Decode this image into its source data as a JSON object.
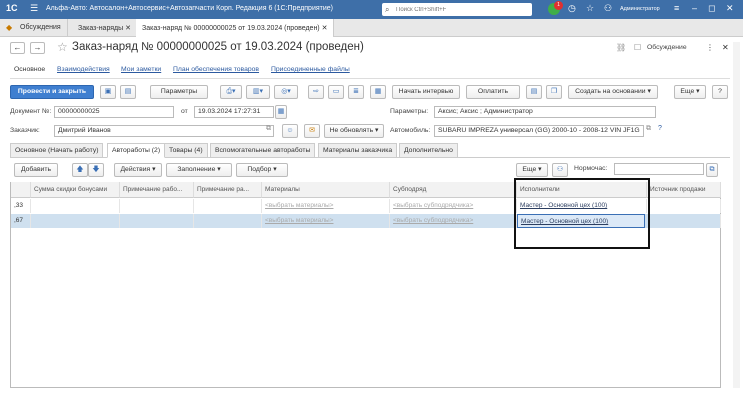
{
  "titlebar": {
    "logo": "1С",
    "title": "Альфа-Авто: Автосалон+Автосервис+Автозапчасти Корп. Редакция 6  (1С:Предприятие)",
    "search_placeholder": "Поиск Ctrl+Shift+F",
    "notif_count": "1",
    "user": "Администратор"
  },
  "tabs": [
    {
      "label": "Обсуждения"
    },
    {
      "label": "Заказ-наряды"
    },
    {
      "label": "Заказ-наряд № 00000000025 от 19.03.2024 (проведен)"
    }
  ],
  "doc": {
    "title": "Заказ-наряд № 00000000025 от 19.03.2024 (проведен)",
    "discussion_label": "Обсуждение",
    "links": [
      "Основное",
      "Взаимодействия",
      "Мои заметки",
      "План обеспечения товаров",
      "Присоединенные файлы"
    ]
  },
  "toolbar": {
    "post_close": "Провести и закрыть",
    "params": "Параметры",
    "start_interview": "Начать интервью",
    "pay": "Оплатить",
    "create_based": "Создать на основании",
    "more": "Еще",
    "help": "?"
  },
  "form": {
    "doc_no_label": "Документ №:",
    "doc_no": "00000000025",
    "from_label": "от",
    "date": "19.03.2024 17:27:31",
    "params_label": "Параметры:",
    "params_value": "Аксис; Аксис ; Администратор",
    "customer_label": "Заказчик:",
    "customer": "Дмитрий Иванов",
    "update_mode": "Не обновлять",
    "car_label": "Автомобиль:",
    "car": "SUBARU IMPREZA универсал (GG) 2000-10 - 2008-12 VIN JF1G"
  },
  "inner_tabs": [
    "Основное (Начать работу)",
    "Автоработы (2)",
    "Товары (4)",
    "Вспомогательные автоработы",
    "Материалы заказчика",
    "Дополнительно"
  ],
  "grid_toolbar": {
    "add": "Добавить",
    "actions": "Действия",
    "fill": "Заполнение",
    "pick": "Подбор",
    "more": "Еще",
    "norm_label": "Нормочас:"
  },
  "grid": {
    "columns": [
      "Сумма скидки бонусами",
      "Примечание рабо...",
      "Примечание ра...",
      "Материалы",
      "Субподряд",
      "Исполнители",
      "Источник продажи"
    ],
    "rows": [
      {
        "sum": ",33",
        "materials": "<выбрать материалы>",
        "subcontract": "<выбрать субподрядчика>",
        "executors": "Мастер - Основной цех (100)"
      },
      {
        "sum": ",67",
        "materials": "<выбрать материалы>",
        "subcontract": "<выбрать субподрядчика>",
        "executors": "Мастер - Основной цех (100)"
      }
    ]
  }
}
